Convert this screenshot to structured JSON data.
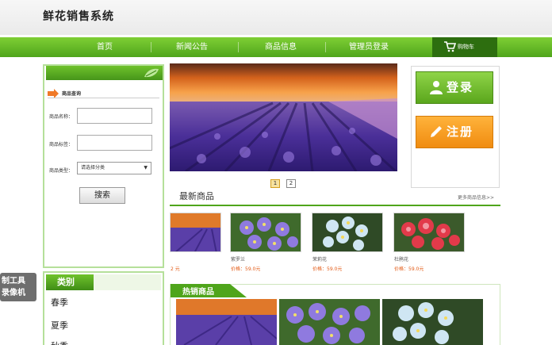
{
  "header": {
    "site_title": "鲜花销售系统"
  },
  "nav": {
    "items": [
      "首页",
      "新闻公告",
      "商品信息",
      "管理员登录"
    ],
    "cart_label": "购物车"
  },
  "search_panel": {
    "title": "商品查询",
    "name_label": "商品名称：",
    "tag_label": "商品标签：",
    "type_label": "商品类型：",
    "type_selected": "请选择分类",
    "search_button": "搜索"
  },
  "category": {
    "title": "类别",
    "items": [
      "春季",
      "夏季",
      "秋季"
    ]
  },
  "watermark": {
    "line1": "制工具",
    "line2": "录像机"
  },
  "banner": {
    "pages": [
      "1",
      "2"
    ],
    "current_page": 1
  },
  "newest": {
    "title": "最新商品",
    "more": "更多商品信息>>",
    "products": [
      {
        "name": "",
        "price": "2 元"
      },
      {
        "name": "紫罗兰",
        "price": "价格：59.0元"
      },
      {
        "name": "茉莉花",
        "price": "价格：59.0元"
      },
      {
        "name": "杜鹃花",
        "price": "价格：59.0元"
      }
    ]
  },
  "hot": {
    "title": "热销商品"
  },
  "auth": {
    "login": "登录",
    "register": "注册"
  },
  "colors": {
    "brand_green": "#4fa51b",
    "orange": "#f59a1e",
    "price": "#e35a15"
  }
}
